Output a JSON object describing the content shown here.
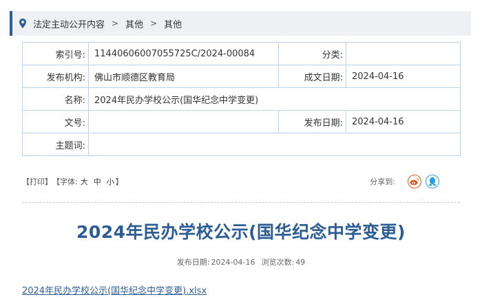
{
  "breadcrumb": {
    "items": [
      "法定主动公开内容",
      "其他",
      "其他"
    ],
    "separator": ">"
  },
  "meta": {
    "index_label": "索引号:",
    "index_value": "11440606007055725C/2024-00084",
    "category_label": "分类:",
    "category_value": "",
    "publisher_label": "发布机构:",
    "publisher_value": "佛山市顺德区教育局",
    "created_label": "成文日期:",
    "created_value": "2024-04-16",
    "name_label": "名称:",
    "name_value": "2024年民办学校公示(国华纪念中学变更)",
    "docno_label": "文号:",
    "docno_value": "",
    "published_label": "发布日期:",
    "published_value": "2024-04-16",
    "subject_label": "主题词:",
    "subject_value": ""
  },
  "tools": {
    "print": "【打印】",
    "font_open": "【字体:",
    "font_large": "大",
    "font_medium": "中",
    "font_small": "小",
    "font_close": "】",
    "share_label": "分享到:",
    "share_icons": [
      "weibo-icon",
      "qq-icon"
    ],
    "weibo_color": "#e0541b",
    "qq_color": "#2a9fe3"
  },
  "article": {
    "title": "2024年民办学校公示(国华纪念中学变更)",
    "publish_label": "发布日期:",
    "publish_date": "2024-04-16",
    "views_label": "浏览次数:",
    "views_count": "49",
    "attachment": "2024年民办学校公示(国华纪念中学变更).xlsx"
  },
  "colors": {
    "accent": "#2c5d95",
    "table_border": "#b9d3ee",
    "breadcrumb_bg": "#eef0f3"
  }
}
